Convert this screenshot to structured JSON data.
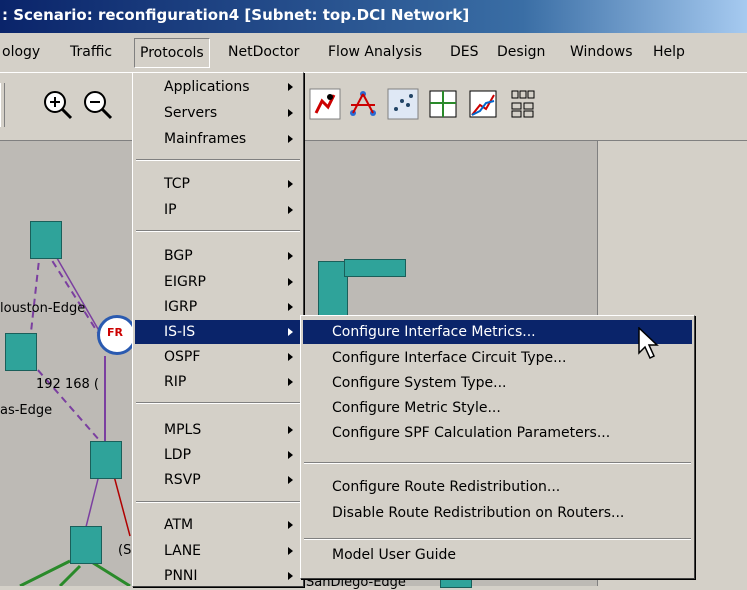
{
  "window": {
    "title": ": Scenario: reconfiguration4  [Subnet: top.DCI Network]"
  },
  "menubar": {
    "items": [
      "ology",
      "Traffic",
      "Protocols",
      "NetDoctor",
      "Flow Analysis",
      "DES",
      "Design",
      "Windows",
      "Help"
    ]
  },
  "network": {
    "labels": [
      "louston-Edge",
      "192 168 (",
      "as-Edge",
      "(S",
      "SanDiego-Edge"
    ],
    "router_badge": "FR"
  },
  "protocols_menu": {
    "items": [
      "Applications",
      "Servers",
      "Mainframes",
      "TCP",
      "IP",
      "BGP",
      "EIGRP",
      "IGRP",
      "IS-IS",
      "OSPF",
      "RIP",
      "MPLS",
      "LDP",
      "RSVP",
      "ATM",
      "LANE",
      "PNNI"
    ],
    "highlighted": "IS-IS"
  },
  "isis_submenu": {
    "items": [
      "Configure Interface Metrics...",
      "Configure Interface Circuit Type...",
      "Configure System Type...",
      "Configure Metric Style...",
      "Configure SPF Calculation Parameters...",
      "Configure Route Redistribution...",
      "Disable Route Redistribution on Routers...",
      "Model User Guide"
    ],
    "highlighted": "Configure Interface Metrics..."
  },
  "colors": {
    "highlight": "#0a246a",
    "menu_bg": "#d4d0c8",
    "link_purple": "#7b3fa0",
    "link_green": "#2a8a2a",
    "node_teal": "#2fa39a"
  }
}
